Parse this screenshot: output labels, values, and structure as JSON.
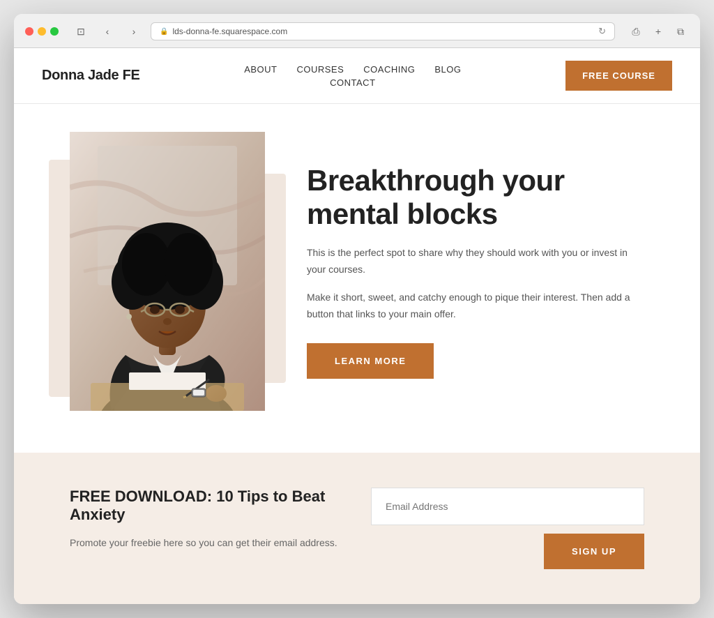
{
  "browser": {
    "url": "lds-donna-fe.squarespace.com",
    "refresh_icon": "↻"
  },
  "nav": {
    "logo": "Donna Jade FE",
    "links": [
      {
        "id": "about",
        "label": "ABOUT"
      },
      {
        "id": "courses",
        "label": "COURSES"
      },
      {
        "id": "coaching",
        "label": "COACHING"
      },
      {
        "id": "blog",
        "label": "BLOG"
      },
      {
        "id": "contact",
        "label": "CONTACT"
      }
    ],
    "cta_label": "FREE COURSE"
  },
  "hero": {
    "title": "Breakthrough your mental blocks",
    "desc1": "This is the perfect spot to share why they should work with you or invest in your courses.",
    "desc2": "Make it short, sweet, and catchy enough to pique their interest. Then add a button that links to your main offer.",
    "btn_label": "LEARN MORE"
  },
  "download": {
    "title": "FREE DOWNLOAD: 10 Tips to Beat Anxiety",
    "desc": "Promote your freebie here so you can get their email address.",
    "email_placeholder": "Email Address",
    "btn_label": "SIGN UP"
  }
}
